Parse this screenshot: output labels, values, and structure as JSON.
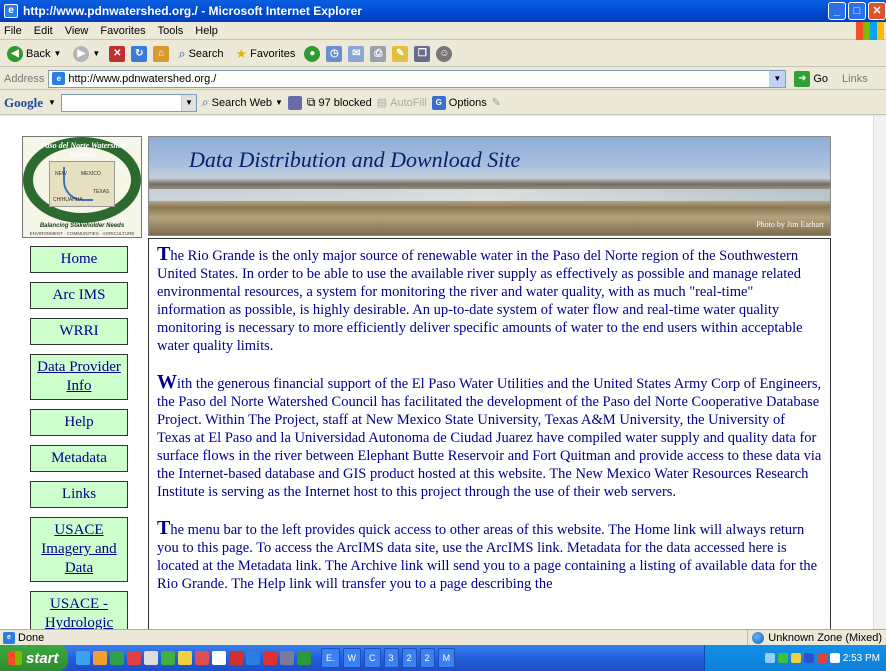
{
  "window": {
    "title": "http://www.pdnwatershed.org./ - Microsoft Internet Explorer"
  },
  "menu": [
    "File",
    "Edit",
    "View",
    "Favorites",
    "Tools",
    "Help"
  ],
  "toolbar": {
    "back": "Back",
    "search": "Search",
    "favorites": "Favorites"
  },
  "address": {
    "label": "Address",
    "url": "http://www.pdnwatershed.org./",
    "go": "Go",
    "links": "Links"
  },
  "google_bar": {
    "logo": "Google",
    "search_web": "Search Web",
    "blocked": "97 blocked",
    "autofill": "AutoFill",
    "options": "Options"
  },
  "logo": {
    "arc_text": "Paso del Norte Watershed Council",
    "labels": [
      "NEW",
      "MEXICO",
      "TEXAS",
      "CHIHUAHUA"
    ],
    "tagline": "Balancing Stakeholder Needs",
    "subline": "ENVIRONMENT · COMMUNITIES · AGRICULTURE"
  },
  "banner": {
    "title": "Data Distribution and Download Site",
    "credit": "Photo by Jim Earhart"
  },
  "nav": [
    {
      "label": "Home",
      "underline": false
    },
    {
      "label": "Arc IMS",
      "underline": false
    },
    {
      "label": "WRRI",
      "underline": false
    },
    {
      "label": "Data Provider Info",
      "underline": true
    },
    {
      "label": "Help",
      "underline": false
    },
    {
      "label": "Metadata",
      "underline": false
    },
    {
      "label": "Links",
      "underline": false
    },
    {
      "label": "USACE Imagery and Data",
      "underline": true
    },
    {
      "label": "USACE - Hydrologic modelling",
      "underline": true
    }
  ],
  "content": {
    "paragraphs": [
      {
        "cap": "T",
        "text": "he Rio Grande is the only major source of renewable water in the Paso del Norte region of the Southwestern United States. In order to be able to use the available river supply as effectively as possible and manage related environmental resources, a system for monitoring the river and water quality, with as much \"real-time\" information as possible, is highly desirable. An up-to-date system of water flow and real-time water quality monitoring is necessary to more efficiently deliver specific amounts of water to the end users within acceptable water quality limits."
      },
      {
        "cap": "W",
        "text": "ith the generous financial support of the El Paso Water Utilities and the United States Army Corp of Engineers, the Paso del Norte Watershed Council has facilitated the development of the Paso del Norte Cooperative Database Project. Within The Project, staff at New Mexico State University, Texas A&M University, the University of Texas at El Paso and la Universidad Autonoma de Ciudad Juarez have compiled water supply and quality data for surface flows in the river between Elephant Butte Reservoir and Fort Quitman and provide access to these data via the Internet-based database and GIS product hosted at this website. The New Mexico Water Resources Research Institute is serving as the Internet host to this project through the use of their web servers."
      },
      {
        "cap": "T",
        "text": "he menu bar to the left provides quick access to other areas of this website. The Home link will always return you to this page. To access the ArcIMS data site, use the ArcIMS link. Metadata for the data accessed here is located at the Metadata link. The Archive link will send you to a page containing a listing of available data for the Rio Grande. The Help link will transfer you to a page describing the"
      }
    ]
  },
  "status": {
    "left": "Done",
    "zone": "Unknown Zone (Mixed)"
  },
  "taskbar": {
    "start": "start",
    "tasks": [
      "E.",
      "W",
      "C",
      "3",
      "2",
      "2",
      "M"
    ],
    "clock": "2:53 PM"
  }
}
